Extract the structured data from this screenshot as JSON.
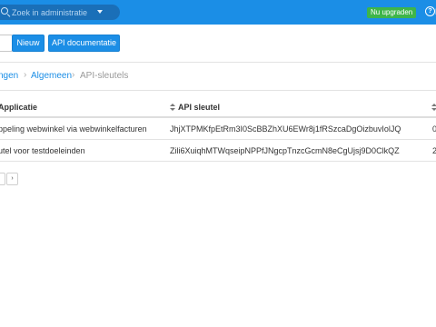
{
  "search": {
    "placeholder": "Zoek in administratie"
  },
  "topbar": {
    "upgrade_label": "Nu upgraden",
    "help_label": "H"
  },
  "toolbar": {
    "new_label": "Nieuw",
    "api_docs_label": "API documentatie"
  },
  "breadcrumb": {
    "items": [
      "ngen",
      "Algemeen",
      "API-sleutels"
    ]
  },
  "table": {
    "headers": [
      "Applicatie",
      "API sleutel",
      ""
    ],
    "rows": [
      {
        "application": "ppeling webwinkel via webwinkelfacturen",
        "api_key": "JhjXTPMKfpEtRm3I0ScBBZhXU6EWr8j1fRSzcaDgOizbuvIolJQ",
        "extra": "0"
      },
      {
        "application": "utel voor testdoeleinden",
        "api_key": "Zili6XuiqhMTWqseipNPPfJNgcpTnzcGcmN8eCgUjsj9D0ClkQZ",
        "extra": "2"
      }
    ]
  },
  "pager": {
    "next_label": "›"
  },
  "colors": {
    "brand": "#1b8ee6",
    "upgrade": "#3eb54a"
  }
}
